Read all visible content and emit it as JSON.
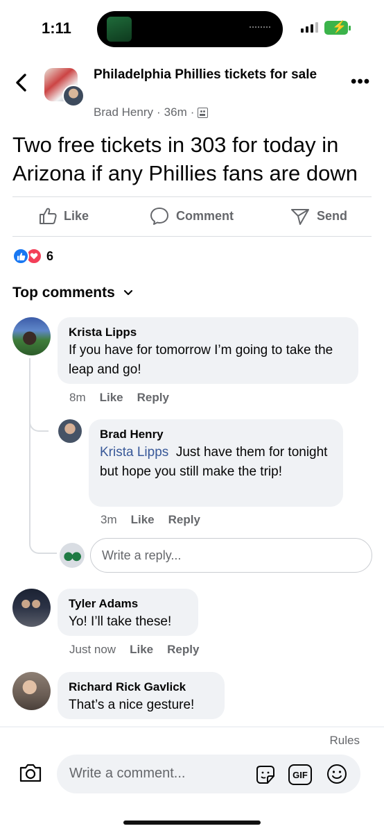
{
  "status_bar": {
    "time": "1:11"
  },
  "header": {
    "group_name": "Philadelphia Phillies tickets for sale",
    "author": "Brad Henry",
    "age": "36m"
  },
  "post": {
    "text": "Two free tickets in 303 for today in Arizona if any Phillies fans are down",
    "actions": {
      "like": "Like",
      "comment": "Comment",
      "send": "Send"
    },
    "reaction_count": "6"
  },
  "comments_header": "Top comments",
  "comments": [
    {
      "author": "Krista Lipps",
      "text": "If you have for tomorrow I’m going to take the leap and go!",
      "time": "8m",
      "like": "Like",
      "reply": "Reply",
      "replies": [
        {
          "author": "Brad Henry",
          "mention": "Krista Lipps",
          "text": "Just have them for tonight but hope you still make the trip!",
          "time": "3m",
          "like": "Like",
          "reply": "Reply"
        }
      ],
      "reply_placeholder": "Write a reply..."
    },
    {
      "author": "Tyler Adams",
      "text": "Yo! I’ll take these!",
      "time": "Just now",
      "like": "Like",
      "reply": "Reply"
    },
    {
      "author": "Richard Rick Gavlick",
      "text": "That’s a nice gesture!"
    }
  ],
  "footer": {
    "rules": "Rules",
    "composer_placeholder": "Write a comment...",
    "gif_label": "GIF"
  },
  "colors": {
    "like_blue": "#1877f2",
    "love_red": "#f33e58",
    "mention": "#385898",
    "bubble": "#f0f2f5",
    "battery": "#3bb34a"
  },
  "icons": [
    "back-arrow-icon",
    "more-icon",
    "privacy-icon",
    "like-icon",
    "comment-icon",
    "send-icon",
    "chevron-down-icon",
    "camera-icon",
    "sticker-icon",
    "gif-icon",
    "emoji-icon"
  ]
}
